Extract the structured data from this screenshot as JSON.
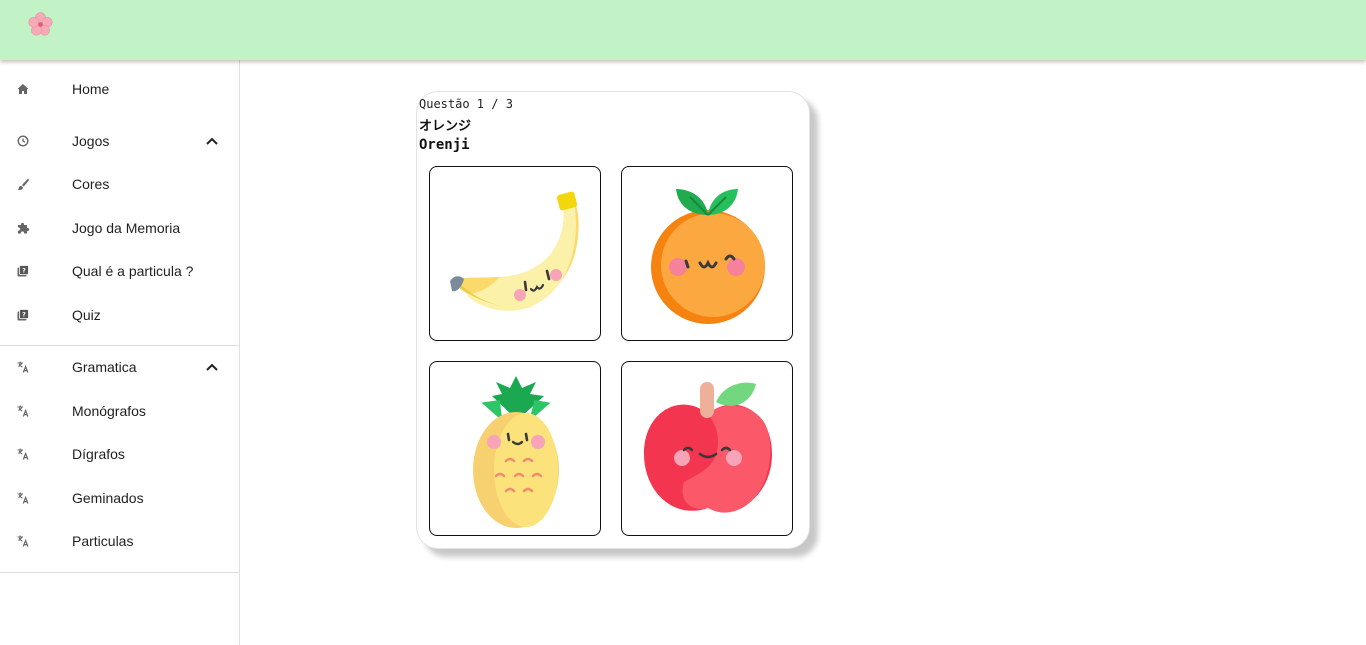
{
  "header": {
    "logo_icon": "sakura-flower-icon",
    "background": "#c1f3c7"
  },
  "sidebar": {
    "home": {
      "label": "Home",
      "icon": "home-icon"
    },
    "jogos": {
      "label": "Jogos",
      "icon": "history-icon",
      "expanded": true,
      "items": [
        {
          "label": "Cores",
          "icon": "brush-icon"
        },
        {
          "label": "Jogo da Memoria",
          "icon": "puzzle-icon"
        },
        {
          "label": "Qual é a particula ?",
          "icon": "quiz-icon"
        },
        {
          "label": "Quiz",
          "icon": "quiz-icon"
        }
      ]
    },
    "gramatica": {
      "label": "Gramatica",
      "icon": "translate-icon",
      "expanded": true,
      "items": [
        {
          "label": "Monógrafos",
          "icon": "translate-icon"
        },
        {
          "label": "Dígrafos",
          "icon": "translate-icon"
        },
        {
          "label": "Geminados",
          "icon": "translate-icon"
        },
        {
          "label": "Particulas",
          "icon": "translate-icon"
        }
      ]
    }
  },
  "quiz": {
    "question_counter": "Questão 1 / 3",
    "kana": "オレンジ",
    "romaji": "Orenji",
    "options": [
      {
        "image": "banana-icon"
      },
      {
        "image": "orange-icon"
      },
      {
        "image": "pineapple-icon"
      },
      {
        "image": "apple-icon"
      }
    ]
  }
}
